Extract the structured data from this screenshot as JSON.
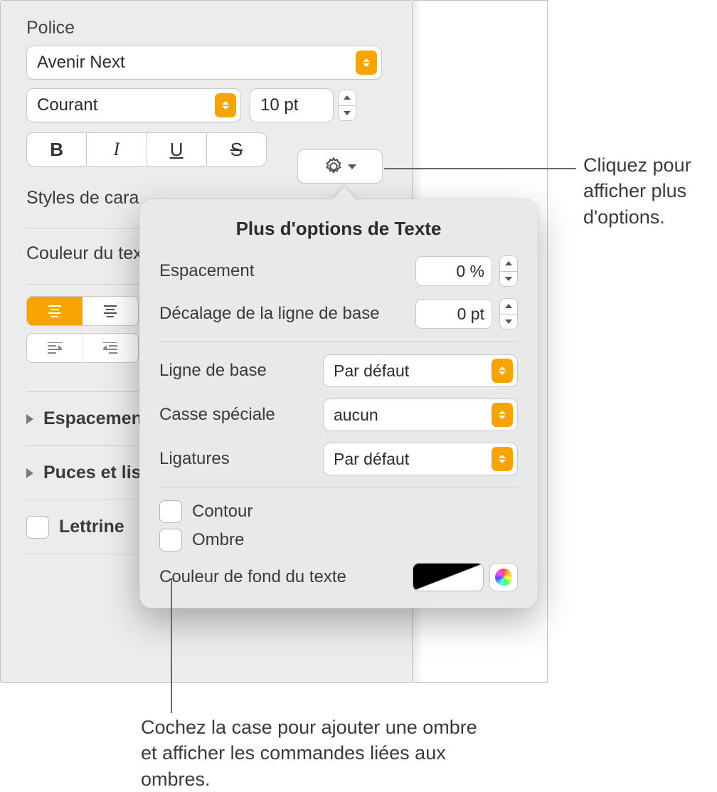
{
  "sidebar": {
    "heading": "Police",
    "font_family": "Avenir Next",
    "font_weight": "Courant",
    "font_size": "10 pt",
    "char_styles": "Styles de cara",
    "text_color": "Couleur du tex",
    "spacing_row": "Espacemen",
    "bullets_row": "Puces et lis",
    "dropcap_row": "Lettrine"
  },
  "popover": {
    "title": "Plus d'options de Texte",
    "spacing_label": "Espacement",
    "spacing_value": "0 %",
    "baseline_shift_label": "Décalage de la ligne de base",
    "baseline_shift_value": "0 pt",
    "baseline_label": "Ligne de base",
    "baseline_value": "Par défaut",
    "caps_label": "Casse spéciale",
    "caps_value": "aucun",
    "ligatures_label": "Ligatures",
    "ligatures_value": "Par défaut",
    "outline_label": "Contour",
    "shadow_label": "Ombre",
    "bgcolor_label": "Couleur de fond du texte"
  },
  "callouts": {
    "gear": "Cliquez pour afficher plus d'options.",
    "shadow": "Cochez la case pour ajouter une ombre et afficher les commandes liées aux ombres."
  }
}
